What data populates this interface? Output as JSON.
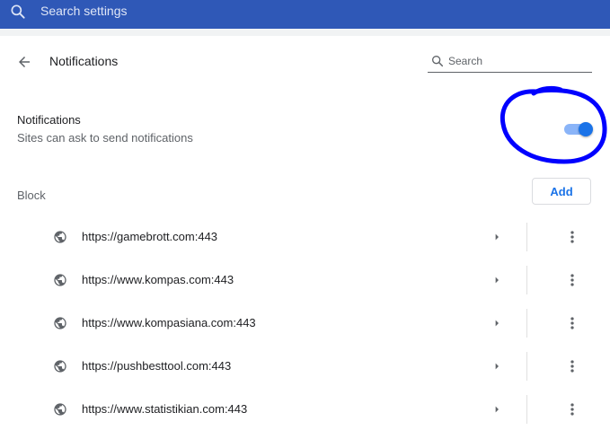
{
  "topbar": {
    "search_placeholder": "Search settings",
    "icon": "search-icon"
  },
  "header": {
    "back_icon": "arrow-back-icon",
    "title": "Notifications",
    "search_placeholder": "Search",
    "search_icon": "search-icon"
  },
  "notifications": {
    "title": "Notifications",
    "subtitle": "Sites can ask to send notifications",
    "toggle_on": true,
    "accent": "#1a73e8"
  },
  "block": {
    "label": "Block",
    "add_label": "Add",
    "sites": [
      {
        "url": "https://gamebrott.com:443"
      },
      {
        "url": "https://www.kompas.com:443"
      },
      {
        "url": "https://www.kompasiana.com:443"
      },
      {
        "url": "https://pushbesttool.com:443"
      },
      {
        "url": "https://www.statistikian.com:443"
      }
    ],
    "site_icon": "globe-icon",
    "arrow_icon": "arrow-right-icon",
    "more_icon": "more-vert-icon"
  },
  "colors": {
    "topbar": "#2f58b7",
    "annotation": "#0000ff"
  }
}
